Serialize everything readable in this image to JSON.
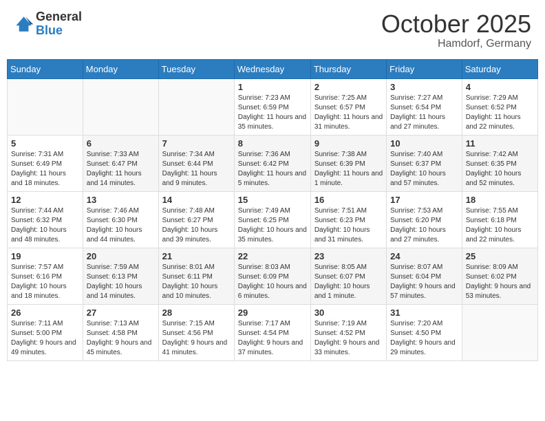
{
  "header": {
    "logo_general": "General",
    "logo_blue": "Blue",
    "month_title": "October 2025",
    "location": "Hamdorf, Germany"
  },
  "weekdays": [
    "Sunday",
    "Monday",
    "Tuesday",
    "Wednesday",
    "Thursday",
    "Friday",
    "Saturday"
  ],
  "weeks": [
    [
      {
        "day": "",
        "info": ""
      },
      {
        "day": "",
        "info": ""
      },
      {
        "day": "",
        "info": ""
      },
      {
        "day": "1",
        "info": "Sunrise: 7:23 AM\nSunset: 6:59 PM\nDaylight: 11 hours and 35 minutes."
      },
      {
        "day": "2",
        "info": "Sunrise: 7:25 AM\nSunset: 6:57 PM\nDaylight: 11 hours and 31 minutes."
      },
      {
        "day": "3",
        "info": "Sunrise: 7:27 AM\nSunset: 6:54 PM\nDaylight: 11 hours and 27 minutes."
      },
      {
        "day": "4",
        "info": "Sunrise: 7:29 AM\nSunset: 6:52 PM\nDaylight: 11 hours and 22 minutes."
      }
    ],
    [
      {
        "day": "5",
        "info": "Sunrise: 7:31 AM\nSunset: 6:49 PM\nDaylight: 11 hours and 18 minutes."
      },
      {
        "day": "6",
        "info": "Sunrise: 7:33 AM\nSunset: 6:47 PM\nDaylight: 11 hours and 14 minutes."
      },
      {
        "day": "7",
        "info": "Sunrise: 7:34 AM\nSunset: 6:44 PM\nDaylight: 11 hours and 9 minutes."
      },
      {
        "day": "8",
        "info": "Sunrise: 7:36 AM\nSunset: 6:42 PM\nDaylight: 11 hours and 5 minutes."
      },
      {
        "day": "9",
        "info": "Sunrise: 7:38 AM\nSunset: 6:39 PM\nDaylight: 11 hours and 1 minute."
      },
      {
        "day": "10",
        "info": "Sunrise: 7:40 AM\nSunset: 6:37 PM\nDaylight: 10 hours and 57 minutes."
      },
      {
        "day": "11",
        "info": "Sunrise: 7:42 AM\nSunset: 6:35 PM\nDaylight: 10 hours and 52 minutes."
      }
    ],
    [
      {
        "day": "12",
        "info": "Sunrise: 7:44 AM\nSunset: 6:32 PM\nDaylight: 10 hours and 48 minutes."
      },
      {
        "day": "13",
        "info": "Sunrise: 7:46 AM\nSunset: 6:30 PM\nDaylight: 10 hours and 44 minutes."
      },
      {
        "day": "14",
        "info": "Sunrise: 7:48 AM\nSunset: 6:27 PM\nDaylight: 10 hours and 39 minutes."
      },
      {
        "day": "15",
        "info": "Sunrise: 7:49 AM\nSunset: 6:25 PM\nDaylight: 10 hours and 35 minutes."
      },
      {
        "day": "16",
        "info": "Sunrise: 7:51 AM\nSunset: 6:23 PM\nDaylight: 10 hours and 31 minutes."
      },
      {
        "day": "17",
        "info": "Sunrise: 7:53 AM\nSunset: 6:20 PM\nDaylight: 10 hours and 27 minutes."
      },
      {
        "day": "18",
        "info": "Sunrise: 7:55 AM\nSunset: 6:18 PM\nDaylight: 10 hours and 22 minutes."
      }
    ],
    [
      {
        "day": "19",
        "info": "Sunrise: 7:57 AM\nSunset: 6:16 PM\nDaylight: 10 hours and 18 minutes."
      },
      {
        "day": "20",
        "info": "Sunrise: 7:59 AM\nSunset: 6:13 PM\nDaylight: 10 hours and 14 minutes."
      },
      {
        "day": "21",
        "info": "Sunrise: 8:01 AM\nSunset: 6:11 PM\nDaylight: 10 hours and 10 minutes."
      },
      {
        "day": "22",
        "info": "Sunrise: 8:03 AM\nSunset: 6:09 PM\nDaylight: 10 hours and 6 minutes."
      },
      {
        "day": "23",
        "info": "Sunrise: 8:05 AM\nSunset: 6:07 PM\nDaylight: 10 hours and 1 minute."
      },
      {
        "day": "24",
        "info": "Sunrise: 8:07 AM\nSunset: 6:04 PM\nDaylight: 9 hours and 57 minutes."
      },
      {
        "day": "25",
        "info": "Sunrise: 8:09 AM\nSunset: 6:02 PM\nDaylight: 9 hours and 53 minutes."
      }
    ],
    [
      {
        "day": "26",
        "info": "Sunrise: 7:11 AM\nSunset: 5:00 PM\nDaylight: 9 hours and 49 minutes."
      },
      {
        "day": "27",
        "info": "Sunrise: 7:13 AM\nSunset: 4:58 PM\nDaylight: 9 hours and 45 minutes."
      },
      {
        "day": "28",
        "info": "Sunrise: 7:15 AM\nSunset: 4:56 PM\nDaylight: 9 hours and 41 minutes."
      },
      {
        "day": "29",
        "info": "Sunrise: 7:17 AM\nSunset: 4:54 PM\nDaylight: 9 hours and 37 minutes."
      },
      {
        "day": "30",
        "info": "Sunrise: 7:19 AM\nSunset: 4:52 PM\nDaylight: 9 hours and 33 minutes."
      },
      {
        "day": "31",
        "info": "Sunrise: 7:20 AM\nSunset: 4:50 PM\nDaylight: 9 hours and 29 minutes."
      },
      {
        "day": "",
        "info": ""
      }
    ]
  ]
}
